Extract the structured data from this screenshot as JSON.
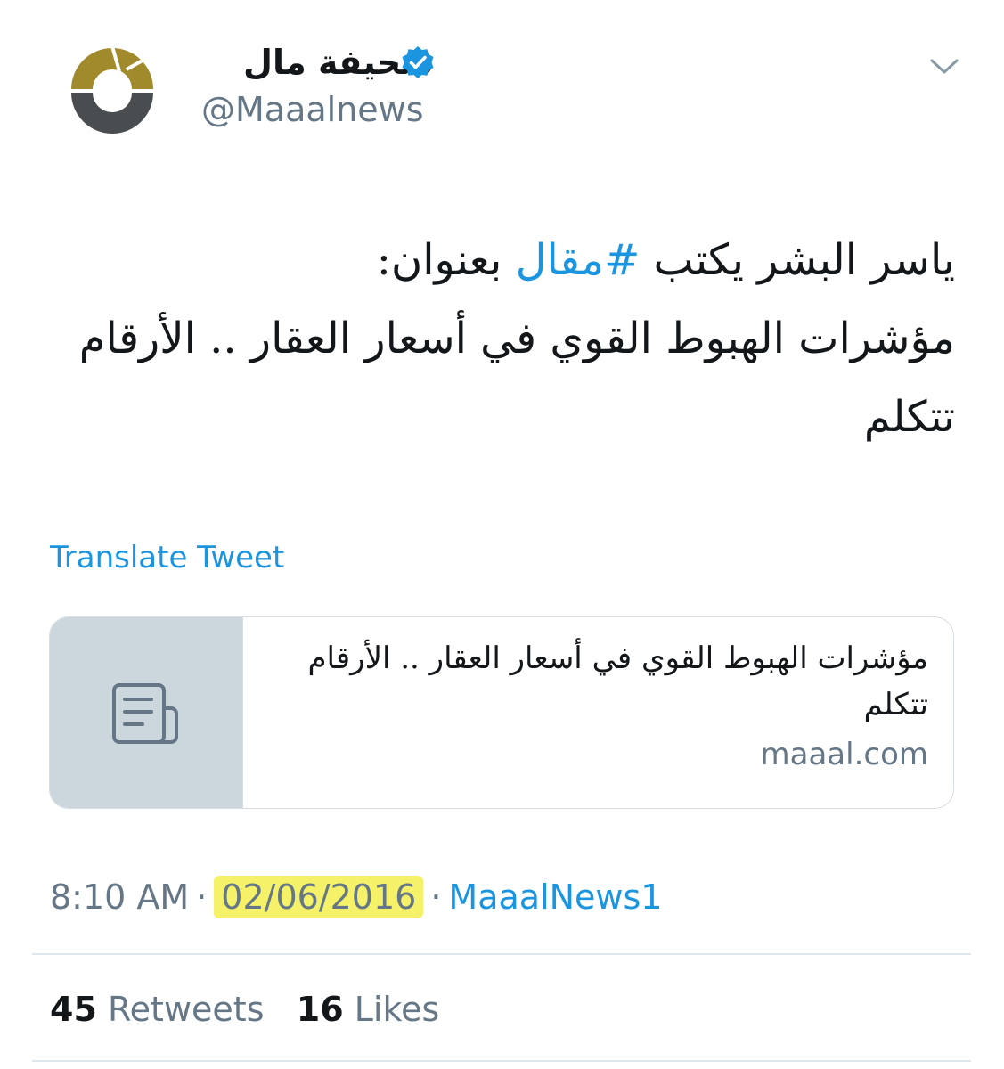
{
  "tweet": {
    "author": {
      "display_name": "صحيفة مال",
      "handle": "@Maaalnews",
      "verified": true,
      "avatar_icon": "maaal-logo-icon"
    },
    "menu_icon": "chevron-down-icon",
    "text": {
      "line1_prefix": "ياسر البشر يكتب ",
      "hashtag": "#مقال",
      "line1_suffix": " بعنوان:",
      "line2": "مؤشرات الهبوط القوي في أسعار العقار .. الأرقام",
      "line3": "تتكلم"
    },
    "translate_label": "Translate Tweet",
    "card": {
      "icon": "article-icon",
      "title": "مؤشرات الهبوط القوي في أسعار العقار .. الأرقام تتكلم",
      "domain": "maaal.com"
    },
    "meta": {
      "time": "8:10 AM",
      "separator": "·",
      "date": "02/06/2016",
      "source": "MaaalNews1"
    },
    "stats": {
      "retweets_count": "45",
      "retweets_label": "Retweets",
      "likes_count": "16",
      "likes_label": "Likes"
    }
  },
  "colors": {
    "link": "#1b95e0",
    "secondary_text": "#657786",
    "primary_text": "#14171a",
    "highlight": "#f5f26a",
    "card_thumb_bg": "#ccd6dd",
    "logo_gold": "#a08a2c",
    "logo_dark": "#4a4d50"
  }
}
